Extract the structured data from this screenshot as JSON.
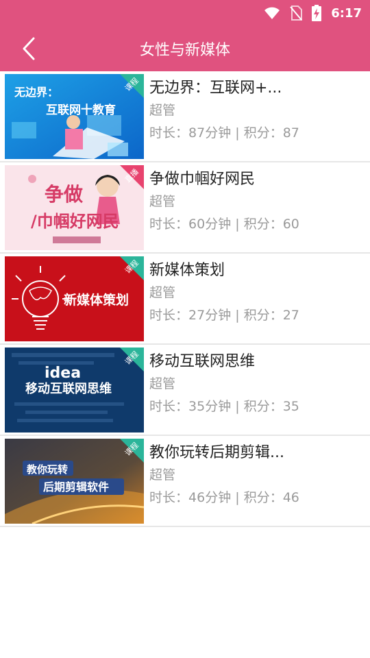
{
  "status_bar": {
    "time": "6:17"
  },
  "header": {
    "title": "女性与新媒体",
    "back_icon": "chevron-left-icon"
  },
  "courses": [
    {
      "title": "无边界：互联网+...",
      "author": "超管",
      "duration_label": "时长：",
      "duration": "87分钟",
      "separator": "|",
      "points_label": "积分：",
      "points": "87",
      "badge": "课程",
      "thumb_text_1": "无边界：",
      "thumb_text_2": "互联网十教育"
    },
    {
      "title": "争做巾帼好网民",
      "author": "超管",
      "duration_label": "时长：",
      "duration": "60分钟",
      "separator": "|",
      "points_label": "积分：",
      "points": "60",
      "badge": "直播",
      "thumb_text_1": "争做",
      "thumb_text_2": "/巾帼好网民"
    },
    {
      "title": "新媒体策划",
      "author": "超管",
      "duration_label": "时长：",
      "duration": "27分钟",
      "separator": "|",
      "points_label": "积分：",
      "points": "27",
      "badge": "课程",
      "thumb_text_1": "新媒体策划",
      "thumb_text_2": ""
    },
    {
      "title": "移动互联网思维",
      "author": "超管",
      "duration_label": "时长：",
      "duration": "35分钟",
      "separator": "|",
      "points_label": "积分：",
      "points": "35",
      "badge": "课程",
      "thumb_text_1": "idea",
      "thumb_text_2": "移动互联网思维"
    },
    {
      "title": "教你玩转后期剪辑...",
      "author": "超管",
      "duration_label": "时长：",
      "duration": "46分钟",
      "separator": "|",
      "points_label": "积分：",
      "points": "46",
      "badge": "课程",
      "thumb_text_1": "教你玩转",
      "thumb_text_2": "后期剪辑软件"
    }
  ],
  "colors": {
    "primary": "#e0527f",
    "badge_course": "#2bb59a",
    "badge_live": "#e8436e"
  }
}
